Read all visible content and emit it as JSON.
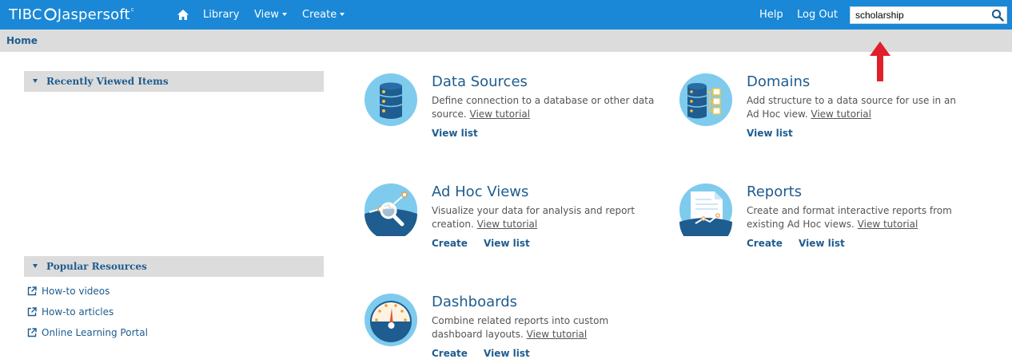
{
  "topbar": {
    "logo_left": "TIBC",
    "logo_right": "Jaspersoft",
    "nav_library": "Library",
    "nav_view": "View",
    "nav_create": "Create",
    "nav_help": "Help",
    "nav_logout": "Log Out",
    "search_value": "scholarship"
  },
  "breadcrumb": {
    "home": "Home"
  },
  "sidebar": {
    "recent_title": "Recently Viewed Items",
    "popular_title": "Popular Resources",
    "links": [
      "How-to videos",
      "How-to articles",
      "Online Learning Portal"
    ]
  },
  "cards": {
    "data_sources": {
      "title": "Data Sources",
      "desc": "Define connection to a database or other data source.",
      "tutorial": "View tutorial",
      "view_list": "View list"
    },
    "domains": {
      "title": "Domains",
      "desc": "Add structure to a data source for use in an Ad Hoc view.",
      "tutorial": "View tutorial",
      "view_list": "View list"
    },
    "adhoc": {
      "title": "Ad Hoc Views",
      "desc": "Visualize your data for analysis and report creation.",
      "tutorial": "View tutorial",
      "create": "Create",
      "view_list": "View list"
    },
    "reports": {
      "title": "Reports",
      "desc": "Create and format interactive reports from existing Ad Hoc views.",
      "tutorial": "View tutorial",
      "create": "Create",
      "view_list": "View list"
    },
    "dashboards": {
      "title": "Dashboards",
      "desc": "Combine related reports into custom dashboard layouts.",
      "tutorial": "View tutorial",
      "create": "Create",
      "view_list": "View list"
    }
  },
  "colors": {
    "topbar": "#1a88d6",
    "link": "#1f5c8f",
    "icon_light": "#7ecbee",
    "icon_dark": "#1f5c8f",
    "annotation": "#e0202a"
  }
}
